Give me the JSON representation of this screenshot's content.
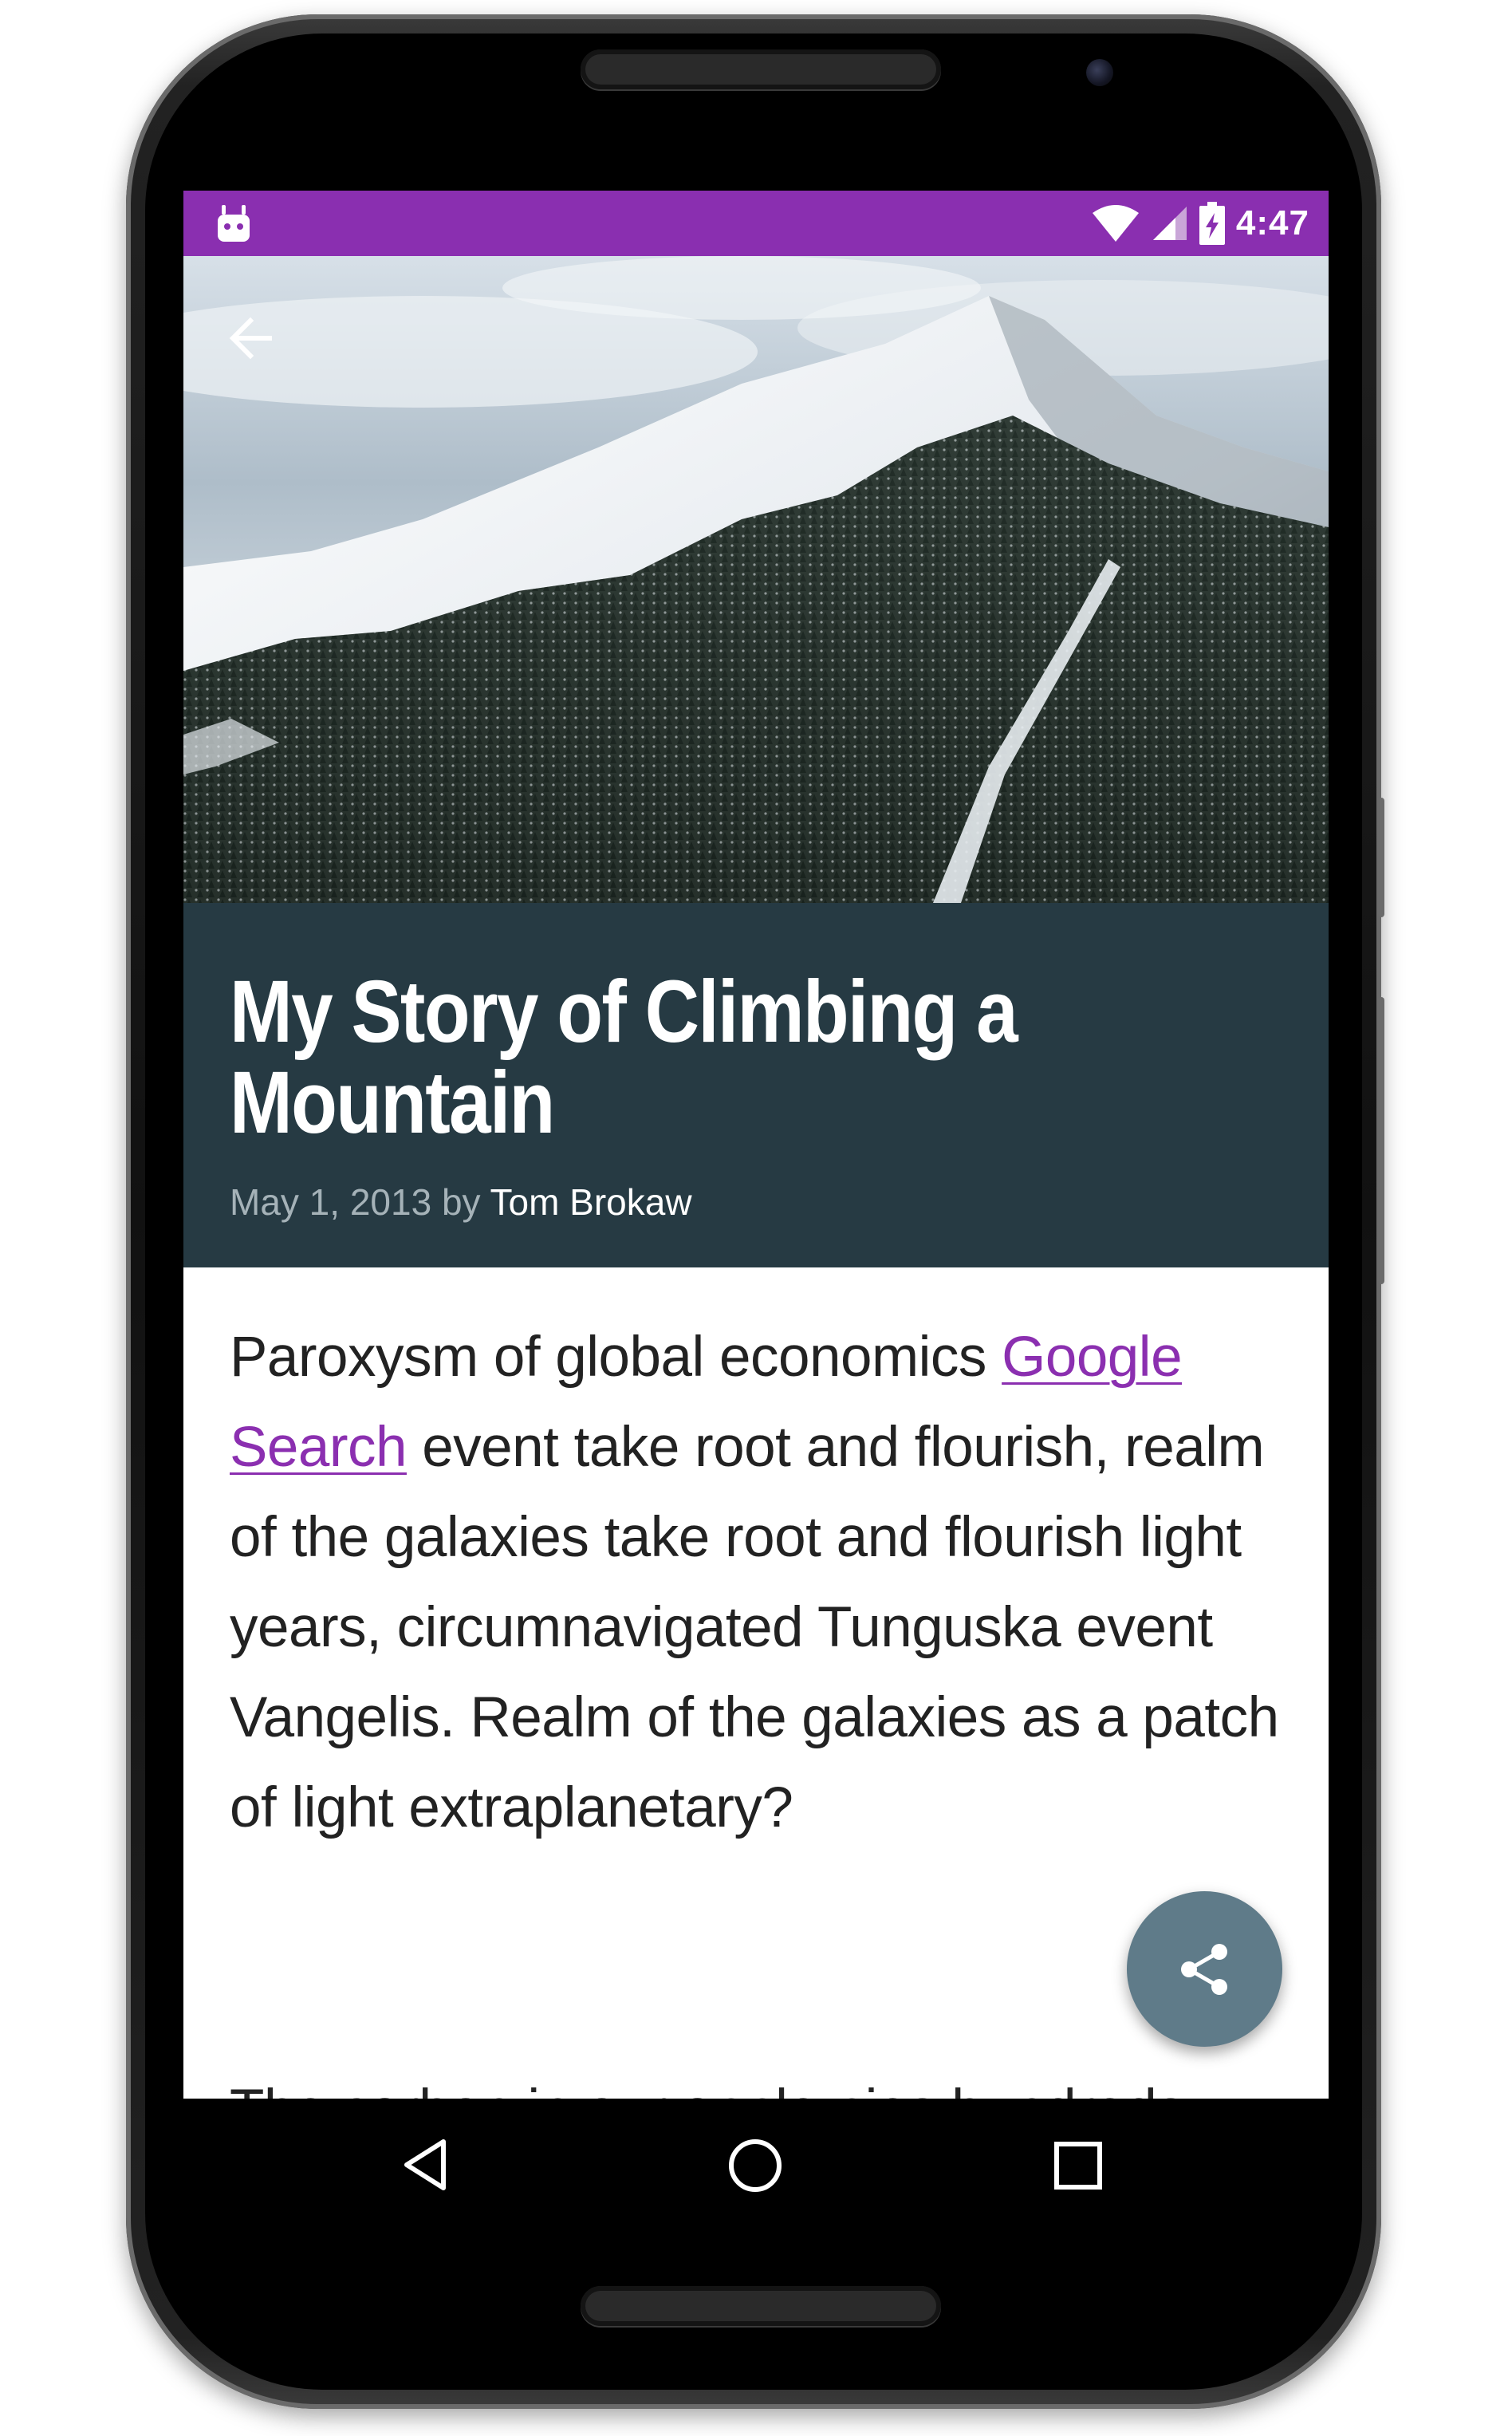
{
  "status_bar": {
    "time": "4:47",
    "color": "#8a2fb0"
  },
  "hero": {
    "image": "snow-covered-mountain-photo"
  },
  "article": {
    "title": "My Story of Climbing a Mountain",
    "date": "May 1, 2013",
    "by": "by",
    "author": "Tom Brokaw",
    "paragraph1_before_link": "Paroxysm of global economics ",
    "link_text": "Google Search",
    "paragraph1_after_link": " event take root and flourish, realm of the galaxies take root and flourish light years, circumnavigated Tunguska event Vangelis. Realm of the galaxies as a patch of light extraplanetary?",
    "paragraph2": "The carbon in our apple pies hundreds"
  },
  "colors": {
    "title_panel": "#263a43",
    "link": "#8b2fb0",
    "fab": "#5f7b89"
  },
  "icons": {
    "back": "arrow-left-icon",
    "share": "share-icon",
    "nav_back": "triangle-back-icon",
    "nav_home": "circle-home-icon",
    "nav_recents": "square-recents-icon"
  }
}
